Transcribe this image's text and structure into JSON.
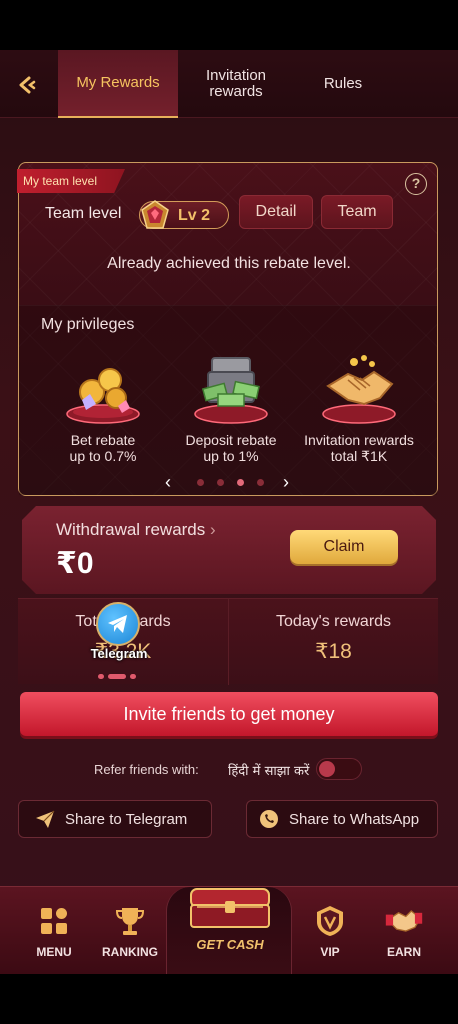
{
  "tabs": [
    {
      "label": "My Rewards",
      "active": true
    },
    {
      "label": "Invitation rewards",
      "active": false
    },
    {
      "label": "Rules",
      "active": false
    }
  ],
  "team_card": {
    "ribbon": "My team level",
    "team_level_label": "Team level",
    "level": "Lv 2",
    "detail_button": "Detail",
    "team_button": "Team",
    "message": "Already achieved this rebate level."
  },
  "privileges": {
    "title": "My privileges",
    "items": [
      {
        "line1": "Bet rebate",
        "line2": "up to 0.7%",
        "icon": "coins-gems-icon"
      },
      {
        "line1": "Deposit rebate",
        "line2": "up to 1%",
        "icon": "cash-chest-icon"
      },
      {
        "line1": "Invitation rewards",
        "line2": "total ₹1K",
        "icon": "handshake-icon"
      }
    ],
    "carousel": {
      "active_index": 2,
      "count": 4
    }
  },
  "withdrawal": {
    "label": "Withdrawal rewards",
    "amount": "₹0",
    "claim": "Claim"
  },
  "rewards": {
    "left_title": "Total rewards",
    "left_value": "₹3.2K",
    "right_title": "Today's rewards",
    "right_value": "₹18"
  },
  "telegram_float": {
    "label": "Telegram"
  },
  "invite_button": "Invite friends to get money",
  "refer": {
    "label": "Refer friends with:",
    "language": "हिंदी में साझा करें",
    "toggle_on": false
  },
  "share": {
    "telegram": "Share to Telegram",
    "whatsapp": "Share to WhatsApp"
  },
  "bottom_nav": {
    "menu": "MENU",
    "ranking": "RANKING",
    "get_cash": "GET CASH",
    "vip": "VIP",
    "earn": "EARN"
  },
  "colors": {
    "accent_gold": "#f6c460",
    "primary_red": "#c3172b",
    "background": "#3b1016"
  }
}
